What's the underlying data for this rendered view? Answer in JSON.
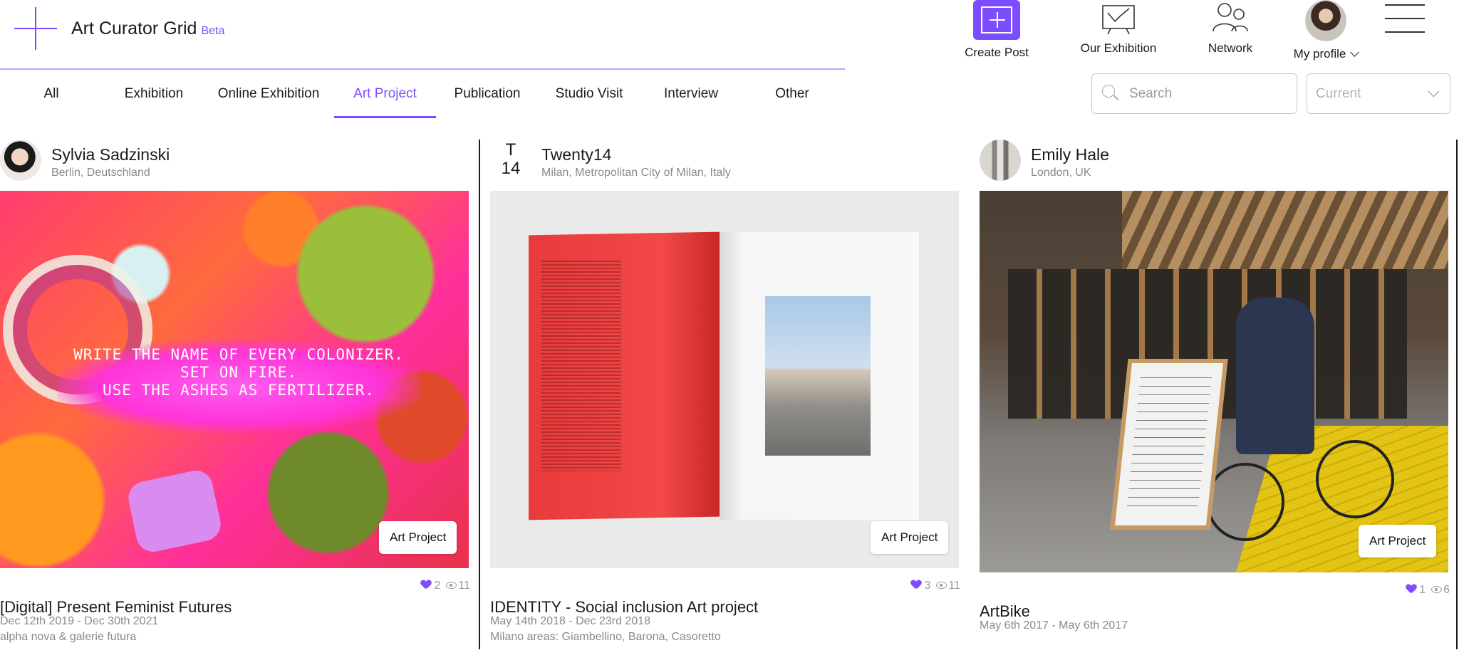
{
  "app": {
    "name": "Art Curator Grid",
    "badge": "Beta"
  },
  "header_nav": {
    "create_post": "Create Post",
    "our_exhibition": "Our Exhibition",
    "network": "Network",
    "my_profile": "My profile"
  },
  "tabs": [
    {
      "label": "All",
      "active": false
    },
    {
      "label": "Exhibition",
      "active": false
    },
    {
      "label": "Online Exhibition",
      "active": false
    },
    {
      "label": "Art Project",
      "active": true
    },
    {
      "label": "Publication",
      "active": false
    },
    {
      "label": "Studio Visit",
      "active": false
    },
    {
      "label": "Interview",
      "active": false
    },
    {
      "label": "Other",
      "active": false
    }
  ],
  "search": {
    "placeholder": "Search",
    "value": ""
  },
  "filter": {
    "selected": "Current"
  },
  "colors": {
    "accent": "#7c4dff"
  },
  "posts": [
    {
      "author": "Sylvia Sadzinski",
      "location": "Berlin, Deutschland",
      "image_text": "WRITE THE NAME OF EVERY COLONIZER.\nSET ON FIRE.\nUSE THE ASHES AS FERTILIZER.",
      "tag": "Art Project",
      "likes": "2",
      "views": "11",
      "title": "[Digital] Present Feminist Futures",
      "dates": "Dec 12th 2019 - Dec 30th 2021",
      "venue": "alpha nova & galerie futura"
    },
    {
      "author": "Twenty14",
      "initials_top": "T",
      "initials_bottom": "14",
      "location": "Milan, Metropolitan City of Milan, Italy",
      "tag": "Art Project",
      "likes": "3",
      "views": "11",
      "title": "IDENTITY - Social inclusion Art project",
      "dates": "May 14th 2018 - Dec 23rd 2018",
      "venue": "Milano areas: Giambellino, Barona, Casoretto"
    },
    {
      "author": "Emily Hale",
      "location": "London, UK",
      "tag": "Art Project",
      "likes": "1",
      "views": "6",
      "title": "ArtBike",
      "dates": "May 6th 2017 - May 6th 2017"
    }
  ]
}
